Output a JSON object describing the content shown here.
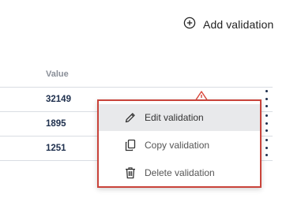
{
  "toolbar": {
    "add_validation_label": "Add validation",
    "add_icon": "plus-circle-icon"
  },
  "table": {
    "headers": {
      "value": "Value"
    },
    "rows": [
      {
        "value": "32149"
      },
      {
        "value": "1895"
      },
      {
        "value": "1251"
      }
    ]
  },
  "context_menu": {
    "items": [
      {
        "label": "Edit validation",
        "icon": "pencil-icon",
        "highlighted": true
      },
      {
        "label": "Copy validation",
        "icon": "copy-icon",
        "highlighted": false
      },
      {
        "label": "Delete validation",
        "icon": "trash-icon",
        "highlighted": false
      }
    ]
  },
  "colors": {
    "accent_border": "#c9433a",
    "warning": "#d9463a",
    "value_text": "#1e2f4d",
    "highlight_bg": "#e8e9eb"
  }
}
